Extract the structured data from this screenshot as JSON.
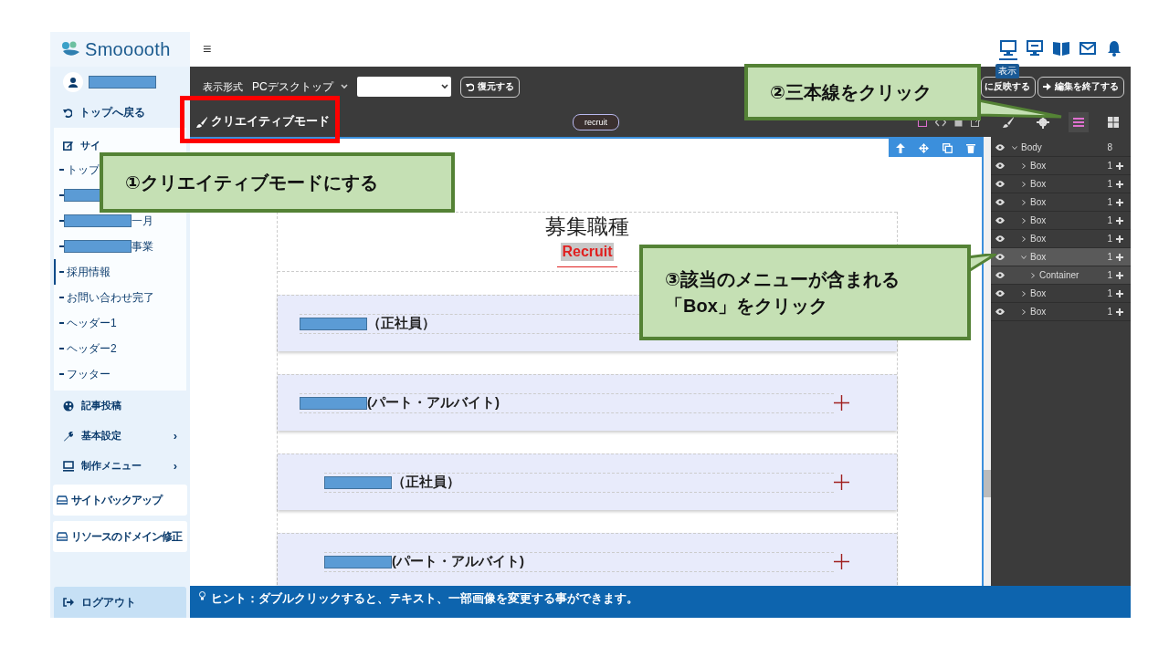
{
  "brand": {
    "name": "Smooooth"
  },
  "header": {
    "menu_glyph": "≡",
    "icons": [
      {
        "kind": "desktop",
        "selected": true
      },
      {
        "kind": "test-monitor",
        "selected": false
      },
      {
        "kind": "book",
        "selected": false
      },
      {
        "kind": "mail",
        "selected": false
      },
      {
        "kind": "bell",
        "selected": false
      }
    ],
    "tooltip": "表示"
  },
  "sidebar": {
    "back": "トップへ戻る",
    "section_label": "サイ",
    "pages": [
      {
        "kind": "text",
        "label": "トップ",
        "selected": false
      },
      {
        "kind": "redacted",
        "selected": false
      },
      {
        "kind": "redacted",
        "label": "一月",
        "selected": false
      },
      {
        "kind": "redacted",
        "label": "事業",
        "selected": false
      },
      {
        "kind": "text",
        "label": "採用情報",
        "selected": true
      },
      {
        "kind": "text",
        "label": "お問い合わせ完了",
        "selected": false
      },
      {
        "kind": "text",
        "label": "ヘッダー1",
        "selected": false
      },
      {
        "kind": "text",
        "label": "ヘッダー2",
        "selected": false
      },
      {
        "kind": "text",
        "label": "フッター",
        "selected": false
      }
    ],
    "menu": [
      {
        "kind": "palette",
        "label": "記事投稿"
      },
      {
        "kind": "wrench",
        "label": "基本設定",
        "submenu_glyph": "›"
      },
      {
        "kind": "monitor",
        "label": "制作メニュー",
        "submenu_glyph": "›"
      }
    ],
    "buttons": [
      "サイトバックアップ",
      "リソースのドメイン修正"
    ],
    "logout": "ログアウト"
  },
  "toolbar": {
    "display_label": "表示形式",
    "device": "PCデスクトップ",
    "restore": "復元する",
    "publish": "に反映する",
    "finish": "編集を終了する",
    "creative_mode": "クリエイティブモード",
    "page_pill": "recruit"
  },
  "panel_tabs": [
    {
      "kind": "brush",
      "selected": false
    },
    {
      "kind": "gear",
      "selected": false
    },
    {
      "kind": "list",
      "selected": true
    },
    {
      "kind": "grid",
      "selected": false
    }
  ],
  "canvas": {
    "heading": "募集職種",
    "subheading": "Recruit",
    "cards": [
      {
        "label": "（正社員）",
        "indented": false,
        "toggle_visible": false
      },
      {
        "label": "(パート・アルバイト)",
        "indented": false,
        "toggle_visible": true
      },
      {
        "label": "（正社員）",
        "indented": true,
        "toggle_visible": true
      },
      {
        "label": "(パート・アルバイト)",
        "indented": true,
        "toggle_visible": true
      }
    ]
  },
  "layers": [
    {
      "label": "Body",
      "count": "8",
      "expanded": true,
      "selected": false,
      "children": [
        {
          "label": "Box",
          "count": "1",
          "expanded": false,
          "selected": false
        },
        {
          "label": "Box",
          "count": "1",
          "expanded": false,
          "selected": false
        },
        {
          "label": "Box",
          "count": "1",
          "expanded": false,
          "selected": false
        },
        {
          "label": "Box",
          "count": "1",
          "expanded": false,
          "selected": false
        },
        {
          "label": "Box",
          "count": "1",
          "expanded": false,
          "selected": false
        },
        {
          "label": "Box",
          "count": "1",
          "expanded": true,
          "selected": true,
          "children": [
            {
              "label": "Container",
              "count": "1",
              "expanded": false,
              "selected": false
            }
          ]
        },
        {
          "label": "Box",
          "count": "1",
          "expanded": false,
          "selected": false
        },
        {
          "label": "Box",
          "count": "1",
          "expanded": false,
          "selected": false
        }
      ]
    }
  ],
  "hint": "ヒント：ダブルクリックすると、テキスト、一部画像を変更する事ができます。",
  "callouts": [
    {
      "lines": [
        "①クリエイティブモードにする"
      ]
    },
    {
      "lines": [
        "②三本線をクリック"
      ]
    },
    {
      "lines": [
        "③該当のメニューが含まれる",
        "「Box」をクリック"
      ]
    }
  ]
}
